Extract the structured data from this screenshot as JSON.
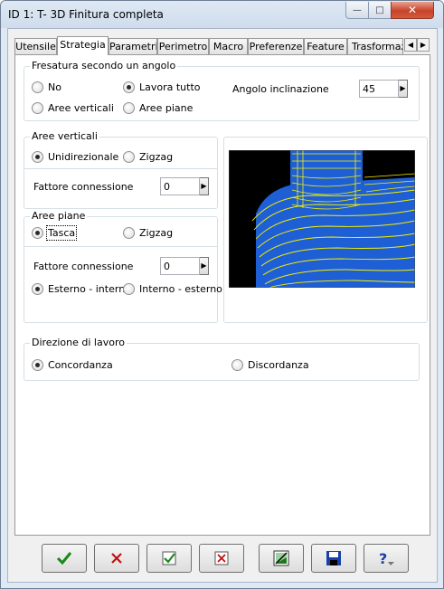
{
  "window": {
    "title": "ID 1: T- 3D Finitura completa"
  },
  "tabs": [
    {
      "label": "Utensile"
    },
    {
      "label": "Strategia"
    },
    {
      "label": "Parametri"
    },
    {
      "label": "Perimetro"
    },
    {
      "label": "Macro"
    },
    {
      "label": "Preferenze"
    },
    {
      "label": "Feature"
    },
    {
      "label": "Trasformaz"
    }
  ],
  "active_tab": "Strategia",
  "fresatura": {
    "title": "Fresatura secondo un angolo",
    "no_label": "No",
    "lavora_tutto_label": "Lavora tutto",
    "aree_verticali_label": "Aree verticali",
    "aree_piane_label": "Aree piane",
    "angolo_label": "Angolo inclinazione",
    "angolo_value": "45"
  },
  "aree_verticali": {
    "title": "Aree verticali",
    "unidirezionale_label": "Unidirezionale",
    "zigzag_label": "Zigzag",
    "fattore_label": "Fattore connessione",
    "fattore_value": "0"
  },
  "aree_piane": {
    "title": "Aree piane",
    "tasca_label": "Tasca",
    "zigzag_label": "Zigzag",
    "fattore_label": "Fattore connessione",
    "fattore_value": "0",
    "esterno_interno_label": "Esterno - interno",
    "interno_esterno_label": "Interno - esterno"
  },
  "direzione": {
    "title": "Direzione di lavoro",
    "concordanza_label": "Concordanza",
    "discordanza_label": "Discordanza"
  },
  "colors": {
    "preview_bg": "#000000",
    "preview_blue": "#1f5fd6",
    "preview_yellow": "#f4f000",
    "ok_green": "#1a8a1a",
    "cancel_red": "#c01010",
    "save_blue": "#1b3fa8"
  },
  "bottom_buttons": [
    {
      "icon": "checkmark-icon"
    },
    {
      "icon": "cross-icon"
    },
    {
      "icon": "check-box-icon"
    },
    {
      "icon": "cross-box-icon"
    },
    {
      "icon": "preview-image-icon"
    },
    {
      "icon": "save-disk-icon"
    },
    {
      "icon": "help-question-icon"
    }
  ]
}
